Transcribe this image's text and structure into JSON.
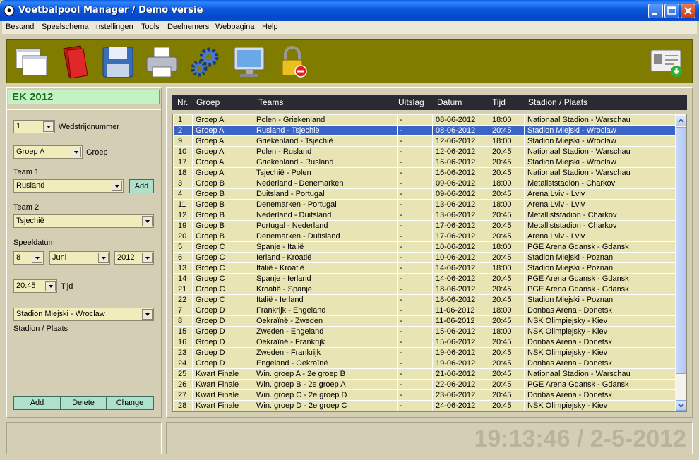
{
  "window": {
    "title": "Voetbalpool Manager / Demo versie"
  },
  "menu": [
    "Bestand",
    "Speelschema",
    "Instellingen",
    "Tools",
    "Deelnemers",
    "Webpagina",
    "Help"
  ],
  "toolbar": {
    "buttons": [
      "windows-icon",
      "folder-icon",
      "save-icon",
      "printer-icon",
      "settings-gears-icon",
      "monitor-icon",
      "lock-icon",
      "user-card-add-icon"
    ],
    "background": "#807c00"
  },
  "pool": {
    "title": "EK 2012"
  },
  "form": {
    "match_number": "1",
    "match_number_label": "Wedstrijdnummer",
    "group": "Groep A",
    "group_label": "Groep",
    "team1_label": "Team 1",
    "team1": "Rusland",
    "add_team_label": "Add",
    "team2_label": "Team 2",
    "team2": "Tsjechië",
    "date_label": "Speeldatum",
    "day": "8",
    "month": "Juni",
    "year": "2012",
    "time": "20:45",
    "time_label": "Tijd",
    "stadium": "Stadion Miejski - Wroclaw",
    "stadium_label": "Stadion / Plaats",
    "add_label": "Add",
    "delete_label": "Delete",
    "change_label": "Change"
  },
  "grid": {
    "columns": [
      "Nr.",
      "Groep",
      "Teams",
      "Uitslag",
      "Datum",
      "Tijd",
      "Stadion / Plaats"
    ],
    "selected_index": 1,
    "rows": [
      [
        "1",
        "Groep A",
        "Polen - Griekenland",
        "-",
        "08-06-2012",
        "18:00",
        "Nationaal Stadion - Warschau"
      ],
      [
        "2",
        "Groep A",
        "Rusland - Tsjechië",
        "-",
        "08-06-2012",
        "20:45",
        "Stadion Miejski - Wroclaw"
      ],
      [
        "9",
        "Groep A",
        "Griekenland - Tsjechië",
        "-",
        "12-06-2012",
        "18:00",
        "Stadion Miejski - Wroclaw"
      ],
      [
        "10",
        "Groep A",
        "Polen - Rusland",
        "-",
        "12-06-2012",
        "20:45",
        "Nationaal Stadion - Warschau"
      ],
      [
        "17",
        "Groep A",
        "Griekenland - Rusland",
        "-",
        "16-06-2012",
        "20:45",
        "Stadion Miejski - Wroclaw"
      ],
      [
        "18",
        "Groep A",
        "Tsjechië - Polen",
        "-",
        "16-06-2012",
        "20:45",
        "Nationaal Stadion - Warschau"
      ],
      [
        "3",
        "Groep B",
        "Nederland - Denemarken",
        "-",
        "09-06-2012",
        "18:00",
        "Metaliststadion - Charkov"
      ],
      [
        "4",
        "Groep B",
        "Duitsland - Portugal",
        "-",
        "09-06-2012",
        "20:45",
        "Arena Lviv - Lviv"
      ],
      [
        "11",
        "Groep B",
        "Denemarken - Portugal",
        "-",
        "13-06-2012",
        "18:00",
        "Arena Lviv - Lviv"
      ],
      [
        "12",
        "Groep B",
        "Nederland - Duitsland",
        "-",
        "13-06-2012",
        "20:45",
        "Metalliststadion - Charkov"
      ],
      [
        "19",
        "Groep B",
        "Portugal - Nederland",
        "-",
        "17-06-2012",
        "20:45",
        "Metalliststadion - Charkov"
      ],
      [
        "20",
        "Groep B",
        "Denemarken - Duitsland",
        "-",
        "17-06-2012",
        "20:45",
        "Arena Lviv - Lviv"
      ],
      [
        "5",
        "Groep C",
        "Spanje - Italië",
        "-",
        "10-06-2012",
        "18:00",
        "PGE Arena Gdansk - Gdansk"
      ],
      [
        "6",
        "Groep C",
        "Ierland - Kroatië",
        "-",
        "10-06-2012",
        "20:45",
        "Stadion Miejski - Poznan"
      ],
      [
        "13",
        "Groep C",
        "Italië - Kroatië",
        "-",
        "14-06-2012",
        "18:00",
        "Stadion Miejski - Poznan"
      ],
      [
        "14",
        "Groep C",
        "Spanje - Ierland",
        "-",
        "14-06-2012",
        "20:45",
        "PGE Arena Gdansk - Gdansk"
      ],
      [
        "21",
        "Groep C",
        "Kroatië - Spanje",
        "-",
        "18-06-2012",
        "20:45",
        "PGE Arena Gdansk - Gdansk"
      ],
      [
        "22",
        "Groep C",
        "Italië - Ierland",
        "-",
        "18-06-2012",
        "20:45",
        "Stadion Miejski - Poznan"
      ],
      [
        "7",
        "Groep D",
        "Frankrijk - Engeland",
        "-",
        "11-06-2012",
        "18:00",
        "Donbas Arena - Donetsk"
      ],
      [
        "8",
        "Groep D",
        "Oekraïnë - Zweden",
        "-",
        "11-06-2012",
        "20:45",
        "NSK Olimpiejsky - Kiev"
      ],
      [
        "15",
        "Groep D",
        "Zweden - Engeland",
        "-",
        "15-06-2012",
        "18:00",
        "NSK Olimpiejsky - Kiev"
      ],
      [
        "16",
        "Groep D",
        "Oekraïnë - Frankrijk",
        "-",
        "15-06-2012",
        "20:45",
        "Donbas Arena - Donetsk"
      ],
      [
        "23",
        "Groep D",
        "Zweden - Frankrijk",
        "-",
        "19-06-2012",
        "20:45",
        "NSK Olimpiejsky - Kiev"
      ],
      [
        "24",
        "Groep D",
        "Engeland - Oekraïnë",
        "-",
        "19-06-2012",
        "20:45",
        "Donbas Arena - Donetsk"
      ],
      [
        "25",
        "Kwart Finale",
        "Win. groep A - 2e groep B",
        "-",
        "21-06-2012",
        "20:45",
        "Nationaal Stadion - Warschau"
      ],
      [
        "26",
        "Kwart Finale",
        "Win. groep B - 2e groep A",
        "-",
        "22-06-2012",
        "20:45",
        "PGE Arena Gdansk - Gdansk"
      ],
      [
        "27",
        "Kwart Finale",
        "Win. groep C - 2e groep D",
        "-",
        "23-06-2012",
        "20:45",
        "Donbas Arena - Donetsk"
      ],
      [
        "28",
        "Kwart Finale",
        "Win. groep D - 2e groep C",
        "-",
        "24-06-2012",
        "20:45",
        "NSK Olimpiejsky - Kiev"
      ]
    ]
  },
  "status": {
    "clock": "19:13:46 / 2-5-2012"
  },
  "colors": {
    "selected_row": "#3a64c8",
    "row_bg": "#e8e4b4",
    "pool_title_bg": "#c4f2c4",
    "button_bg": "#aee0cc"
  }
}
